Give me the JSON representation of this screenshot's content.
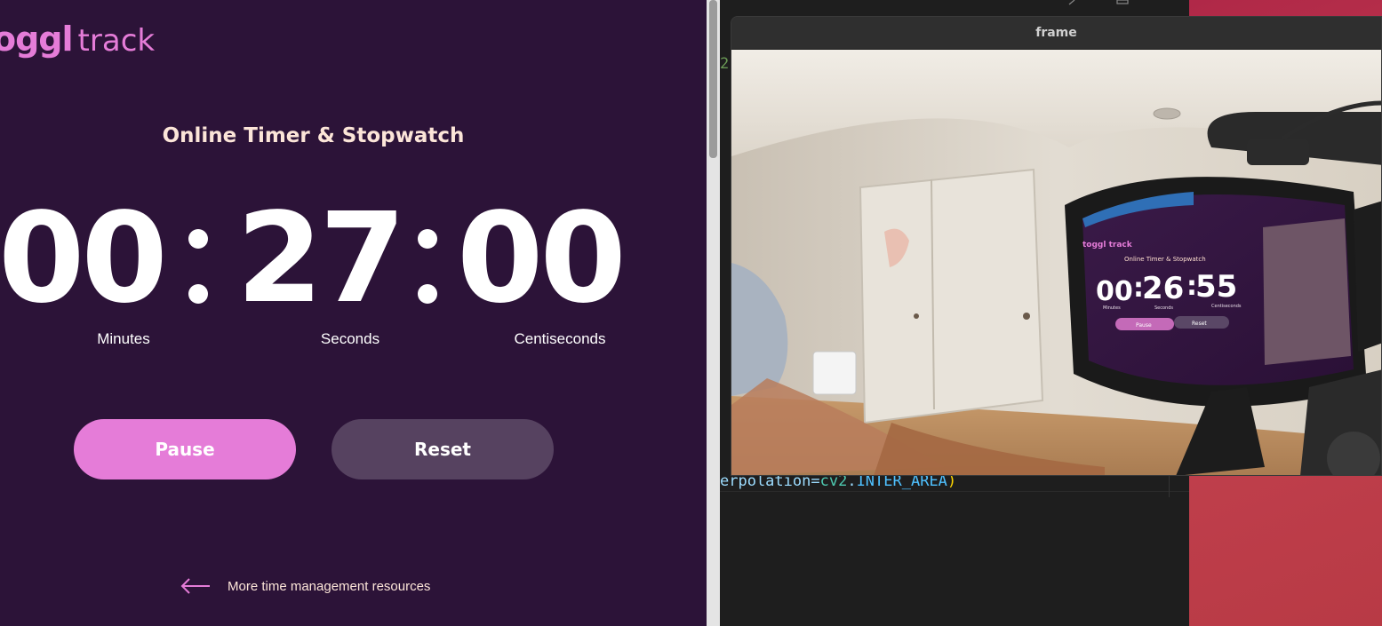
{
  "toggl": {
    "logo_mark": "oggl",
    "logo_word": "track",
    "heading": "Online Timer & Stopwatch",
    "time": {
      "minutes": "00",
      "seconds": "27",
      "centiseconds": "00"
    },
    "labels": {
      "minutes": "Minutes",
      "seconds": "Seconds",
      "centiseconds": "Centiseconds"
    },
    "pause_label": "Pause",
    "reset_label": "Reset",
    "more_link": "More time management resources",
    "colors": {
      "bg": "#2c1338",
      "accent": "#e57cd8",
      "secondary_button": "#564260",
      "text": "#fce5d8"
    }
  },
  "editor": {
    "line_number_fragment": "2",
    "code_tokens": [
      "erpolation=",
      "cv2",
      ".",
      "INTER_AREA",
      ")"
    ]
  },
  "frame_window": {
    "title": "frame",
    "camera_scene": {
      "monitor_logo": "toggl track",
      "monitor_heading": "Online Timer & Stopwatch",
      "monitor_time": {
        "minutes": "00",
        "seconds": "26",
        "centiseconds": "55"
      },
      "monitor_labels": {
        "minutes": "Minutes",
        "seconds": "Seconds",
        "centiseconds": "Centiseconds"
      },
      "monitor_pause": "Pause",
      "monitor_reset": "Reset"
    }
  }
}
